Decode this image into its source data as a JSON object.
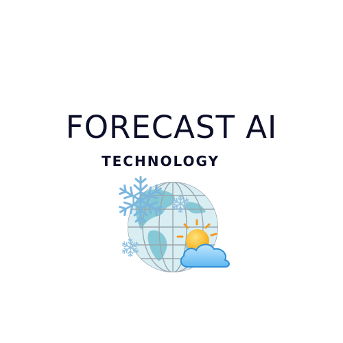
{
  "brand": {
    "title": "FORECAST AI",
    "subtitle": "TECHNOLOGY"
  },
  "logo": {
    "icons": [
      "globe-icon",
      "snowflake-icon",
      "sun-icon",
      "cloud-icon"
    ],
    "colors": {
      "text": "#0d0f2a",
      "globe_ocean": "#cde9f0",
      "globe_land": "#7fc4d4",
      "snowflake": "#7ab6dd",
      "sun": "#f5b50c",
      "cloud": "#5fb8f0"
    }
  }
}
